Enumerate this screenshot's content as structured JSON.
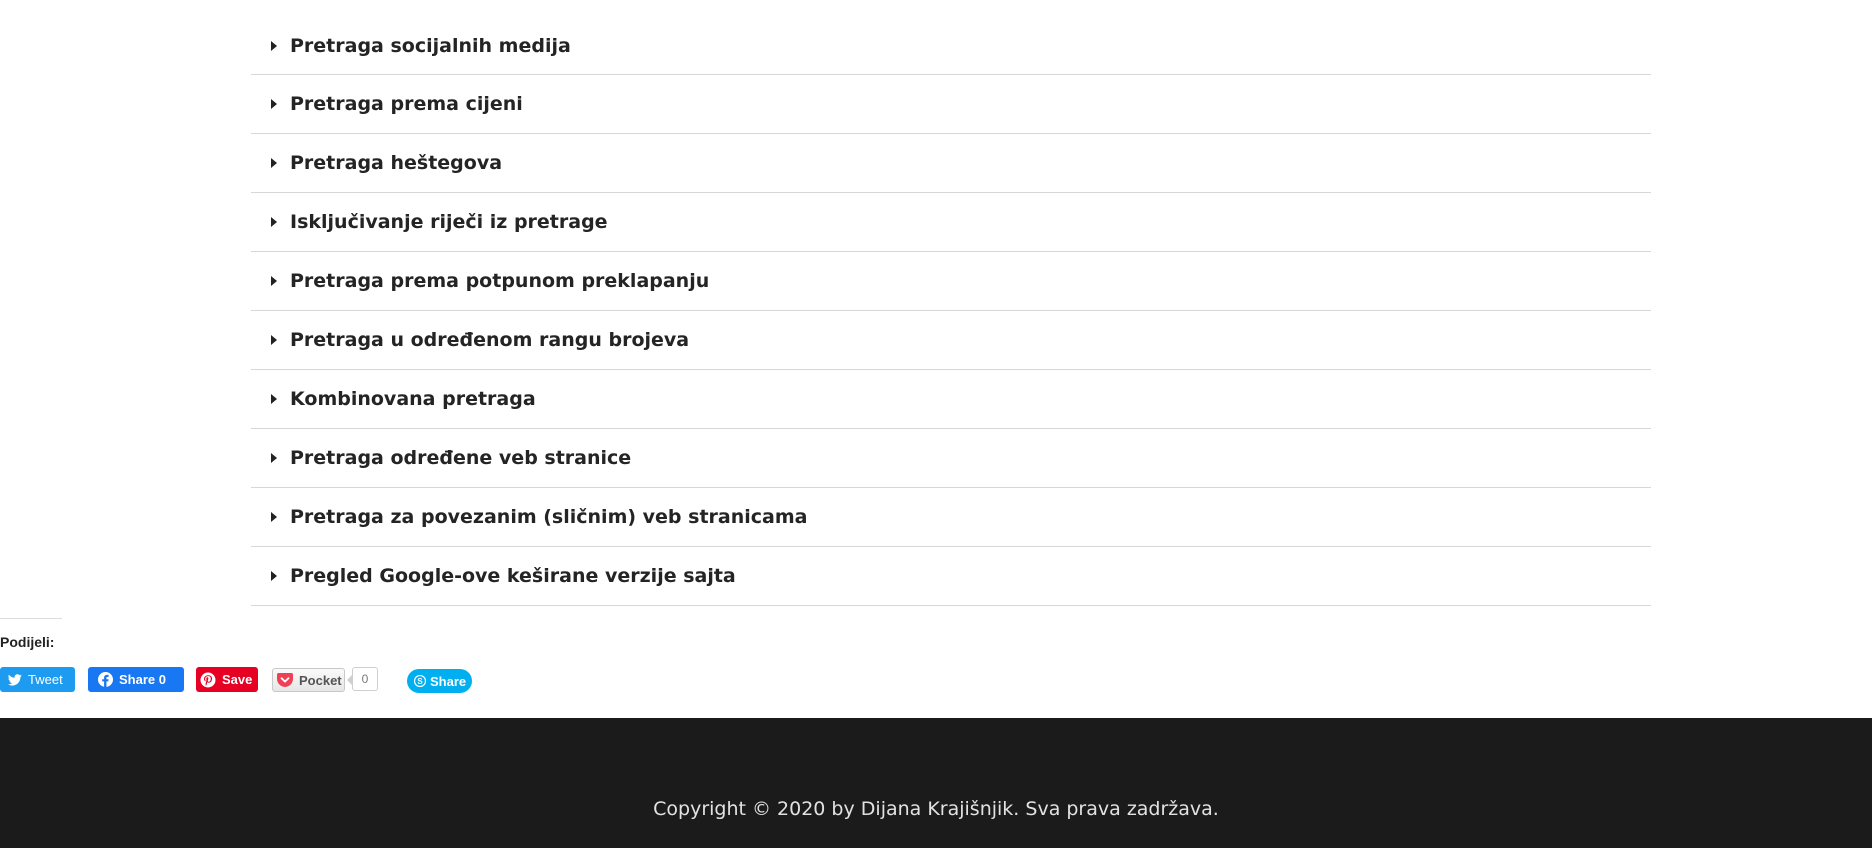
{
  "accordion": {
    "items": [
      {
        "label": "Pretraga socijalnih medija"
      },
      {
        "label": "Pretraga prema cijeni"
      },
      {
        "label": "Pretraga heštegova"
      },
      {
        "label": "Isključivanje riječi iz pretrage"
      },
      {
        "label": "Pretraga prema potpunom preklapanju"
      },
      {
        "label": "Pretraga u određenom rangu brojeva"
      },
      {
        "label": "Kombinovana pretraga"
      },
      {
        "label": "Pretraga određene veb stranice"
      },
      {
        "label": "Pretraga za povezanim (sličnim) veb stranicama"
      },
      {
        "label": "Pregled Google-ove keširane verzije sajta"
      }
    ]
  },
  "share": {
    "heading": "Podijeli:",
    "tweet_label": "Tweet",
    "facebook_label": "Share 0",
    "pinterest_label": "Save",
    "pocket_label": "Pocket",
    "pocket_count": "0",
    "skype_label": "Share"
  },
  "colors": {
    "twitter": "#1d9bf0",
    "facebook": "#1877f2",
    "pinterest": "#e60023",
    "pocket": "#ef4056",
    "skype": "#00aff0",
    "footer_bg": "#1b1b1b"
  },
  "footer": {
    "copyright": "Copyright © 2020 by Dijana Krajišnjik. Sva prava zadržava."
  }
}
